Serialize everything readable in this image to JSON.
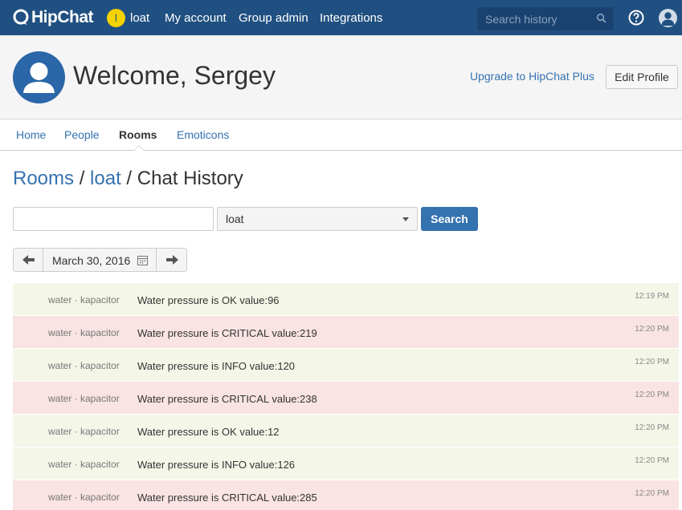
{
  "app": {
    "name": "HipChat"
  },
  "topbar": {
    "user_initial": "l",
    "nav": [
      "loat",
      "My account",
      "Group admin",
      "Integrations"
    ],
    "search_placeholder": "Search history"
  },
  "header": {
    "welcome": "Welcome, Sergey",
    "upgrade_link": "Upgrade to HipChat Plus",
    "edit_profile": "Edit Profile"
  },
  "subnav": {
    "items": [
      "Home",
      "People",
      "Rooms",
      "Emoticons"
    ],
    "active": "Rooms"
  },
  "breadcrumb": {
    "rooms": "Rooms",
    "sep": "/",
    "room": "loat",
    "page": "Chat History"
  },
  "search": {
    "query": "",
    "room_selected": "loat",
    "button": "Search"
  },
  "date_nav": {
    "date": "March 30, 2016"
  },
  "colors": {
    "brand": "#205081",
    "link": "#3572b0",
    "ok_bg": "#f4f7e8",
    "critical_bg": "#f9e3e3"
  },
  "messages": [
    {
      "sender": "water · kapacitor",
      "text": "Water pressure is OK value:96",
      "time": "12:19 PM",
      "level": "ok"
    },
    {
      "sender": "water · kapacitor",
      "text": "Water pressure is CRITICAL value:219",
      "time": "12:20 PM",
      "level": "critical"
    },
    {
      "sender": "water · kapacitor",
      "text": "Water pressure is INFO value:120",
      "time": "12:20 PM",
      "level": "info"
    },
    {
      "sender": "water · kapacitor",
      "text": "Water pressure is CRITICAL value:238",
      "time": "12:20 PM",
      "level": "critical"
    },
    {
      "sender": "water · kapacitor",
      "text": "Water pressure is OK value:12",
      "time": "12:20 PM",
      "level": "ok"
    },
    {
      "sender": "water · kapacitor",
      "text": "Water pressure is INFO value:126",
      "time": "12:20 PM",
      "level": "info"
    },
    {
      "sender": "water · kapacitor",
      "text": "Water pressure is CRITICAL value:285",
      "time": "12:20 PM",
      "level": "critical"
    }
  ]
}
